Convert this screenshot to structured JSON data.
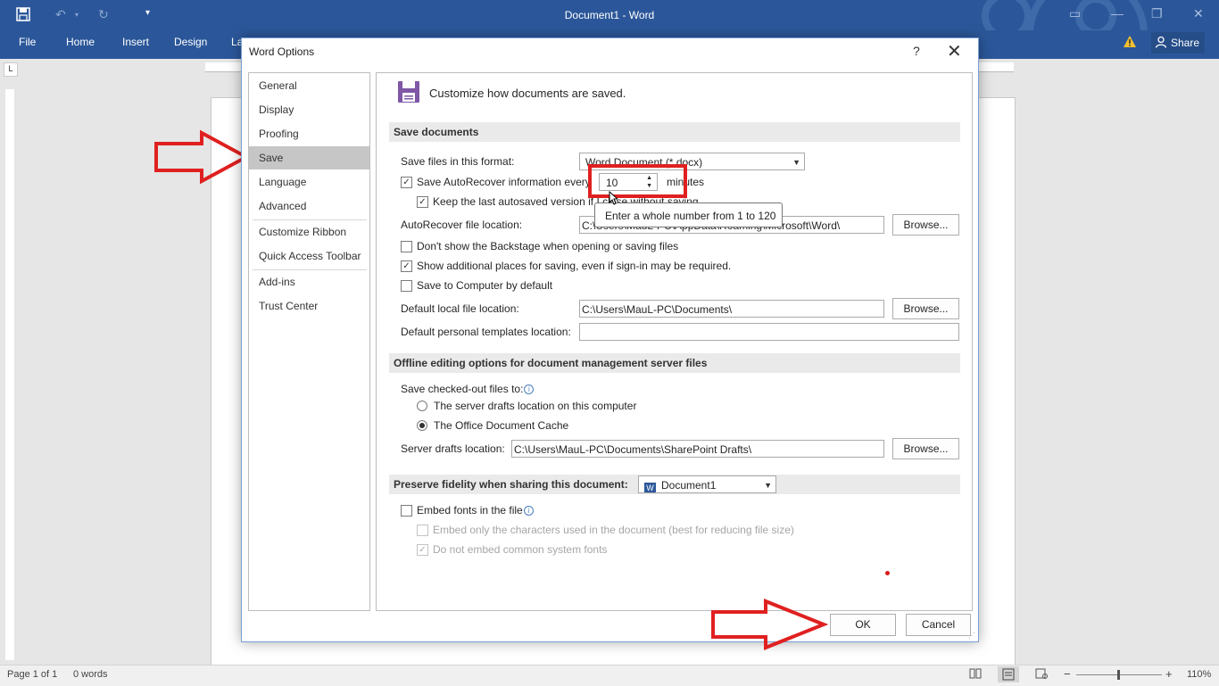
{
  "app": {
    "title": "Document1 - Word",
    "share_label": "Share",
    "ribbon_tabs": [
      "File",
      "Home",
      "Insert",
      "Design",
      "La"
    ]
  },
  "status_bar": {
    "page": "Page 1 of 1",
    "words": "0 words",
    "zoom": "110%"
  },
  "dialog": {
    "title": "Word Options",
    "help": "?",
    "nav_items": [
      "General",
      "Display",
      "Proofing",
      "Save",
      "Language",
      "Advanced",
      "Customize Ribbon",
      "Quick Access Toolbar",
      "Add-ins",
      "Trust Center"
    ],
    "selected_nav": "Save",
    "header_text": "Customize how documents are saved.",
    "sections": {
      "save_documents": "Save documents",
      "offline": "Offline editing options for document management server files",
      "fidelity": "Preserve fidelity when sharing this document:"
    },
    "save_format_label": "Save files in this format:",
    "save_format_value": "Word Document (*.docx)",
    "autorecover_label": "Save AutoRecover information every",
    "autorecover_minutes": "10",
    "minutes_label": "minutes",
    "keep_last_label": "Keep the last autosaved version if I close without saving",
    "autorecover_location_label": "AutoRecover file location:",
    "autorecover_location_value": "C:\\Users\\MauL-PC\\AppData\\Roaming\\Microsoft\\Word\\",
    "browse_label": "Browse...",
    "backstage_label": "Don't show the Backstage when opening or saving files",
    "additional_places_label": "Show additional places for saving, even if sign-in may be required.",
    "save_computer_label": "Save to Computer by default",
    "default_local_label": "Default local file location:",
    "default_local_value": "C:\\Users\\MauL-PC\\Documents\\",
    "templates_label": "Default personal templates location:",
    "templates_value": "",
    "checked_out_label": "Save checked-out files to:",
    "server_drafts_option": "The server drafts location on this computer",
    "office_cache_option": "The Office Document Cache",
    "server_drafts_label": "Server drafts location:",
    "server_drafts_value": "C:\\Users\\MauL-PC\\Documents\\SharePoint Drafts\\",
    "fidelity_doc": "Document1",
    "embed_fonts_label": "Embed fonts in the file",
    "embed_only_label": "Embed only the characters used in the document (best for reducing file size)",
    "no_common_label": "Do not embed common system fonts",
    "tooltip": "Enter a whole number from 1 to 120",
    "ok_label": "OK",
    "cancel_label": "Cancel"
  },
  "colors": {
    "word_blue": "#2b579a",
    "annotation_red": "#e02020",
    "selected_nav_bg": "#c6c6c6"
  }
}
